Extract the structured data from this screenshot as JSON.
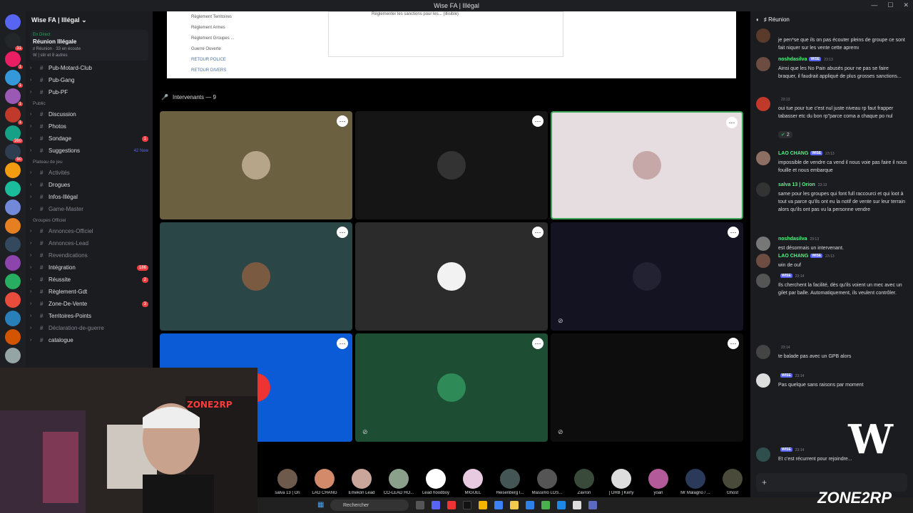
{
  "titlebar": {
    "title": "Wise FA | Illégal"
  },
  "server_badges": [
    "31",
    "1",
    "1",
    "1",
    "1",
    "360",
    "90"
  ],
  "guild": {
    "name": "Wise FA | Illégal"
  },
  "live": {
    "status": "En Direct",
    "title": "Réunion Illégale",
    "channel": "♯ Réunion · 33 en écoute",
    "listeners": "W | stir et 8 autres"
  },
  "channel_groups": {
    "top": [
      {
        "name": "Pub-Motard-Club"
      },
      {
        "name": "Pub-Gang"
      },
      {
        "name": "Pub-PF"
      }
    ],
    "public_label": "Public",
    "public": [
      {
        "name": "Discussion",
        "badge": ""
      },
      {
        "name": "Photos",
        "badge": ""
      },
      {
        "name": "Sondage",
        "badge": "1"
      },
      {
        "name": "Suggestions",
        "badge": "42 New"
      }
    ],
    "plateau_label": "Plateau de jeu",
    "plateau": [
      {
        "name": "Activités",
        "dim": true,
        "badge": ""
      },
      {
        "name": "Drogues",
        "dim": false,
        "badge": ""
      },
      {
        "name": "Infos-Illégal",
        "dim": false,
        "badge": ""
      },
      {
        "name": "Game-Master",
        "dim": true,
        "badge": ""
      }
    ],
    "groupes_label": "Groupes Officiel",
    "groupes": [
      {
        "name": "Annonces-Officiel",
        "dim": true,
        "badge": ""
      },
      {
        "name": "Annonces-Lead",
        "dim": true,
        "badge": ""
      },
      {
        "name": "Revendications",
        "dim": true,
        "badge": ""
      },
      {
        "name": "Intégration",
        "dim": false,
        "badge": "186"
      },
      {
        "name": "Réussite",
        "dim": false,
        "badge": "2"
      },
      {
        "name": "Règlement-Gdt",
        "dim": false,
        "badge": ""
      },
      {
        "name": "Zone-De-Vente",
        "dim": false,
        "badge": "3"
      },
      {
        "name": "Territoires-Points",
        "dim": false,
        "badge": ""
      },
      {
        "name": "Déclaration-de-guerre",
        "dim": true,
        "badge": ""
      },
      {
        "name": "catalogue",
        "dim": false,
        "badge": ""
      }
    ]
  },
  "document": {
    "side_items": [
      "Règlement Territoires",
      "Règlement Armes",
      "Règlement Groupes ...",
      "Guerre Ouverte",
      "RETOUR POLICE",
      "RETOUR DIVERS"
    ],
    "box_text": "Règlementer les sanctions pour les... (illisible)"
  },
  "speakers": {
    "label": "Intervenants — 9"
  },
  "strip": [
    {
      "name": "salva 13 | Ori"
    },
    {
      "name": "LAO CHANG"
    },
    {
      "name": "Emekon Lead"
    },
    {
      "name": "CO-LEAD HO..."
    },
    {
      "name": "Lead hoodboy"
    },
    {
      "name": "MIGUEL"
    },
    {
      "name": "Heisenberg I..."
    },
    {
      "name": "Massimo LOS..."
    },
    {
      "name": "Zavron"
    },
    {
      "name": "[ DRB ] Kerly"
    },
    {
      "name": "yoan"
    },
    {
      "name": "Mr Malagno / ..."
    },
    {
      "name": "Ghost"
    }
  ],
  "chat": {
    "header": "♯ Réunion",
    "messages": [
      {
        "name": "",
        "tag": "",
        "time": "",
        "text": "je pen*se que ils on pas écouter pleins de groupe ce sont fait niquer sur les vente cette apremı",
        "color": "#dbdee1"
      },
      {
        "name": "noshdasilva",
        "tag": "WISE",
        "time": "23:13",
        "text": "Ainsi que les No Pain abusés pour ne pas se faire braquer, il faudrait appliqué de plus grosses sanctions...",
        "color": "#57f287"
      },
      {
        "name": "",
        "tag": "",
        "time": "23:13",
        "text": "oui tue pour tue c'est nul juste niveau rp faut frapper tabasser etc du bon rp\"parce coma a chaque po nul",
        "color": "#5865f2"
      },
      {
        "name": "LAO CHANG",
        "tag": "WISE",
        "time": "23:13",
        "text": "impossible de vendre ca vend il nous voie pas faire il nous fouille et nous embarque",
        "color": "#57f287"
      },
      {
        "name": "salva 13 | Orion",
        "tag": "",
        "time": "23:13",
        "text": "same pour les groupes qui font full raccourci et qui loot à tout va parce qu'ils ont eu la notif de vente sur leur terrain alors qu'ils ont pas vu la personne vendre",
        "color": "#57f287"
      },
      {
        "name": "noshdasilva",
        "tag": "",
        "time": "23:13",
        "text": "est désormais un intervenant.",
        "color": "#57f287"
      },
      {
        "name": "LAO CHANG",
        "tag": "WISE",
        "time": "23:13",
        "text": "win de ouf",
        "color": "#57f287"
      },
      {
        "name": "",
        "tag": "WISE",
        "time": "23:14",
        "text": "Ils cherchent la facilité, dès qu'ils voient un mec avec un gilet par balle. Automatiquement, ils veulent contrôler.",
        "color": "#5865f2"
      },
      {
        "name": "",
        "tag": "",
        "time": "23:14",
        "text": "te balade pas avec un GPB alors",
        "color": "#dbdee1"
      },
      {
        "name": "",
        "tag": "WISE",
        "time": "23:14",
        "text": "Pas quelque sans raisons par moment",
        "color": "#5865f2"
      },
      {
        "name": "",
        "tag": "WISE",
        "time": "23:14",
        "text": "Et c'est récurrent pour rejoindre...",
        "color": "#dbdee1"
      }
    ],
    "reaction": "2",
    "input_placeholder": "+"
  },
  "taskbar": {
    "search": "Rechercher"
  },
  "overlay": {
    "logo": "W",
    "brand": "ZONE2RP"
  }
}
